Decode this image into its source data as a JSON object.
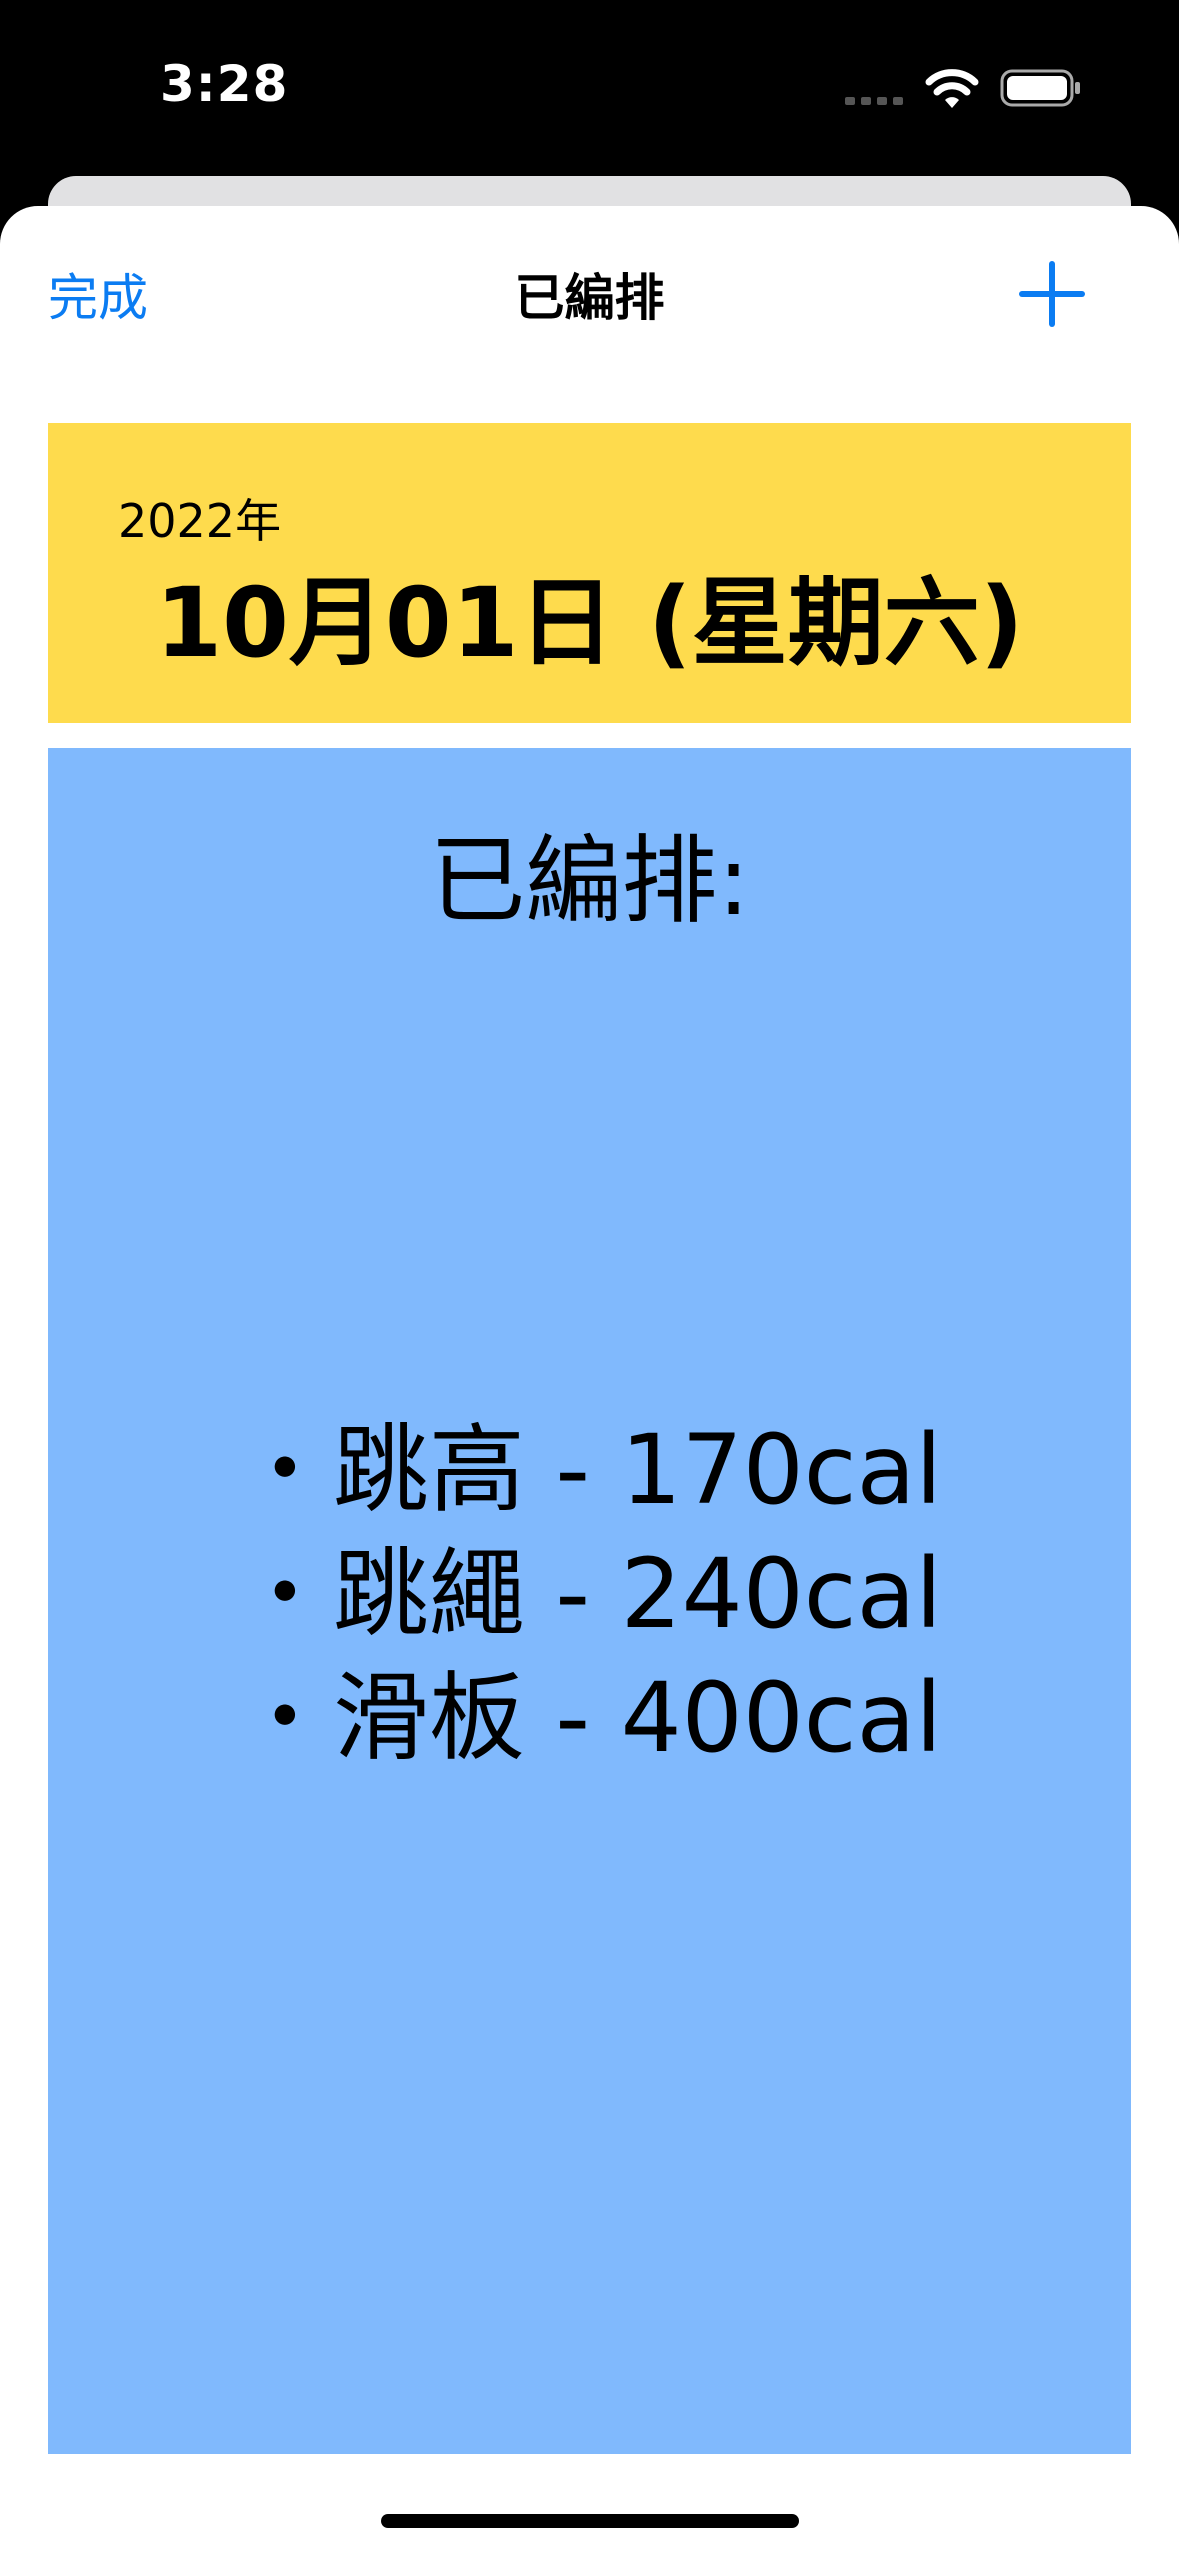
{
  "status_bar": {
    "time": "3:28"
  },
  "nav": {
    "done_label": "完成",
    "title": "已編排",
    "add_icon": "plus-icon",
    "accent_color": "#0b7cf2"
  },
  "date": {
    "year": "2022年",
    "main": "10月01日 (星期六)",
    "background_color": "#fedb4d"
  },
  "scheduled": {
    "heading": "已編排:",
    "background_color": "#80b9fd",
    "items": [
      "・跳高 - 170cal",
      "・跳繩 - 240cal",
      "・滑板 - 400cal"
    ]
  }
}
